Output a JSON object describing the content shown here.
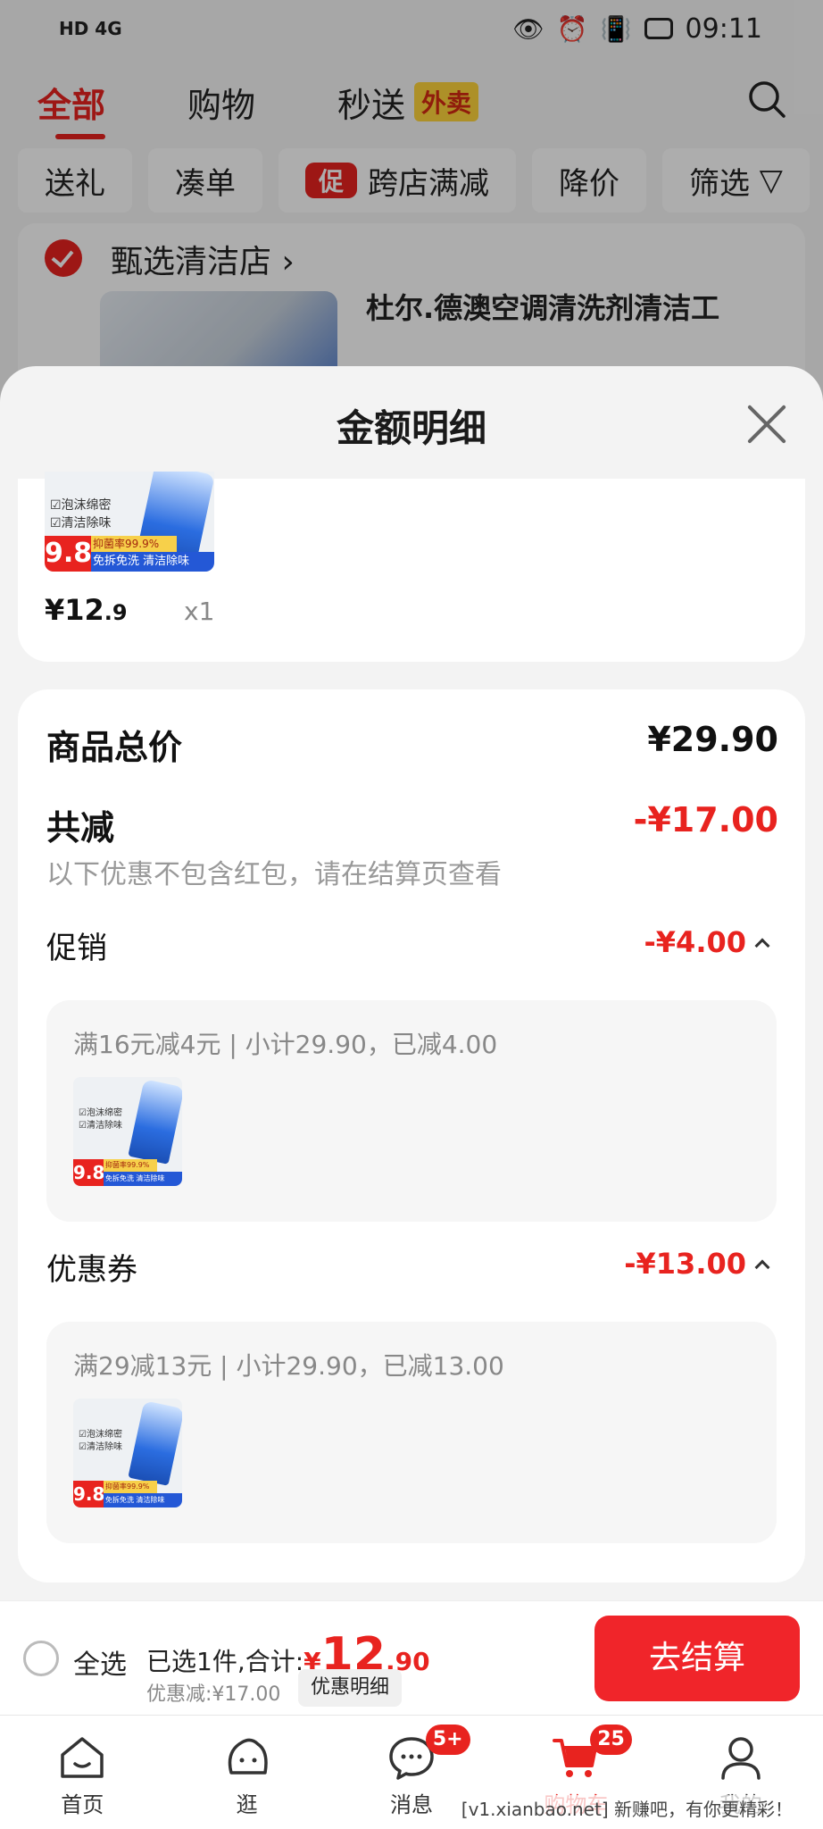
{
  "status_bar": {
    "left": "HD 4G",
    "time": "09:11"
  },
  "top_tabs": [
    {
      "label": "全部",
      "active": true
    },
    {
      "label": "购物"
    },
    {
      "label": "秒送"
    }
  ],
  "waimai_badge": "外卖",
  "filters": [
    "送礼",
    "凑单",
    "跨店满减",
    "降价",
    "筛选"
  ],
  "promo_tag": "促",
  "store": {
    "name": "甄选清洁店 ›",
    "product_title": "杜尔.德澳空调清洗剂清洁工"
  },
  "sheet": {
    "title": "金额明细"
  },
  "thumb": {
    "bullet1": "☑泡沫绵密",
    "bullet2": "☑清洁除味",
    "badge": "9.8",
    "yellow": "抑菌率99.9%",
    "blue": "免拆免洗 清洁除味"
  },
  "item": {
    "price_int": "¥12",
    "price_dec": ".9",
    "qty": "x1"
  },
  "summary": {
    "total_label": "商品总价",
    "total_value": "¥29.90",
    "reduce_label": "共减",
    "reduce_value": "-¥17.00",
    "reduce_note": "以下优惠不包含红包，请在结算页查看",
    "promo_label": "促销",
    "promo_value": "-¥4.00",
    "promo_detail": "满16元减4元 | 小计29.90，已减4.00",
    "coupon_label": "优惠券",
    "coupon_value": "-¥13.00",
    "coupon_detail": "满29减13元 | 小计29.90，已减13.00"
  },
  "checkout": {
    "select_all": "全选",
    "selected_text": "已选1件,合计:",
    "currency": "¥",
    "total_int": "12",
    "total_dec": ".90",
    "discount_text": "优惠减:¥17.00",
    "detail_chip": "优惠明细",
    "button": "去结算"
  },
  "tab_bar": [
    {
      "label": "首页"
    },
    {
      "label": "逛"
    },
    {
      "label": "消息",
      "badge": "5+"
    },
    {
      "label": "购物车",
      "badge": "25",
      "active": true
    },
    {
      "label": "我的"
    }
  ],
  "watermark": "[v1.xianbao.net] 新赚吧，有你更精彩！",
  "colors": {
    "accent": "#e8231f",
    "button": "#f0252a",
    "badge_yellow": "#ffd53c"
  }
}
